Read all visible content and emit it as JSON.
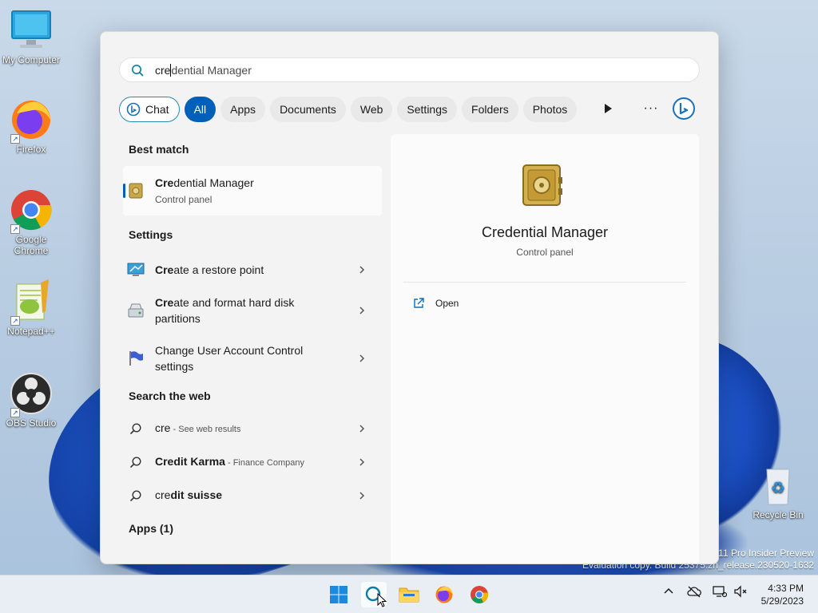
{
  "desktop": {
    "icons": [
      {
        "label": "My Computer",
        "icon": "monitor-icon"
      },
      {
        "label": "Firefox",
        "icon": "firefox-icon"
      },
      {
        "label": "Google Chrome",
        "icon": "chrome-icon"
      },
      {
        "label": "Notepad++",
        "icon": "notepadpp-icon"
      },
      {
        "label": "OBS Studio",
        "icon": "obs-icon"
      },
      {
        "label": "Recycle Bin",
        "icon": "recycle-bin-icon"
      }
    ],
    "watermark": {
      "line1": "11 Pro Insider Preview",
      "line2": "Evaluation copy. Build 25375.zn_release.230520-1632"
    }
  },
  "search": {
    "typed": "cre",
    "completion": "dential Manager",
    "filters": {
      "chat": "Chat",
      "all": "All",
      "apps": "Apps",
      "documents": "Documents",
      "web": "Web",
      "settings": "Settings",
      "folders": "Folders",
      "photos": "Photos"
    }
  },
  "results": {
    "best_match_title": "Best match",
    "best_match": {
      "bold": "Cre",
      "rest": "dential Manager",
      "sub": "Control panel"
    },
    "settings_title": "Settings",
    "settings": [
      {
        "bold": "Cre",
        "rest": "ate a restore point"
      },
      {
        "bold": "Cre",
        "rest": "ate and format hard disk partitions"
      },
      {
        "bold": "",
        "rest": "Change User Account Control settings"
      }
    ],
    "web_title": "Search the web",
    "web": [
      {
        "bold": "",
        "main": "cre",
        "suffix": " - See web results"
      },
      {
        "bold": "Cre",
        "main": "dit Karma",
        "suffix": " - Finance Company"
      },
      {
        "bold": "cre",
        "main": "dit suisse",
        "suffix": ""
      }
    ],
    "apps_title": "Apps (1)"
  },
  "preview": {
    "title": "Credential Manager",
    "subtitle": "Control panel",
    "open_label": "Open"
  },
  "taskbar": {
    "time": "4:33 PM",
    "date": "5/29/2023"
  },
  "colors": {
    "accent": "#005fb8",
    "chat_border": "#2a8ab0"
  }
}
